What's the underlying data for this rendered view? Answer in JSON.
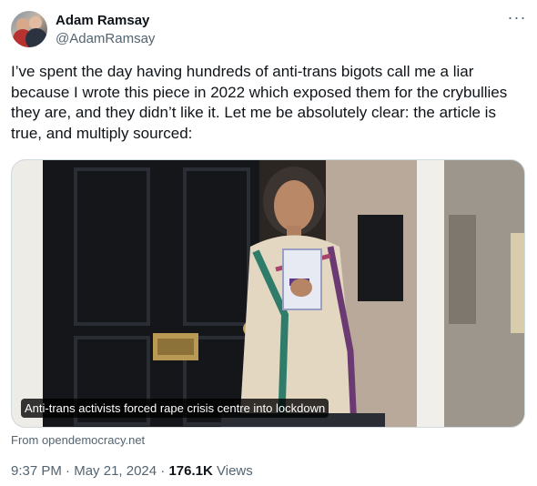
{
  "author": {
    "display_name": "Adam Ramsay",
    "handle": "@AdamRamsay",
    "avatar_icon": "profile-photo"
  },
  "more_icon": "more-horizontal-icon",
  "more_glyph": "···",
  "tweet_text": "I’ve spent the day having hundreds of anti-trans bigots call me a liar because I wrote this piece in 2022 which exposed them for the crybullies they are, and they didn’t like it. Let me be absolutely clear: the article is true, and multiply sourced:",
  "card": {
    "caption": "Anti-trans activists forced rape crisis centre into lockdown",
    "source": "From opendemocracy.net"
  },
  "meta": {
    "time": "9:37 PM",
    "separator": " · ",
    "date": "May 21, 2024",
    "views_count": "176.1K",
    "views_label": " Views"
  },
  "colors": {
    "text_primary": "#0f1419",
    "text_secondary": "#536471",
    "border": "#cfd9de"
  }
}
